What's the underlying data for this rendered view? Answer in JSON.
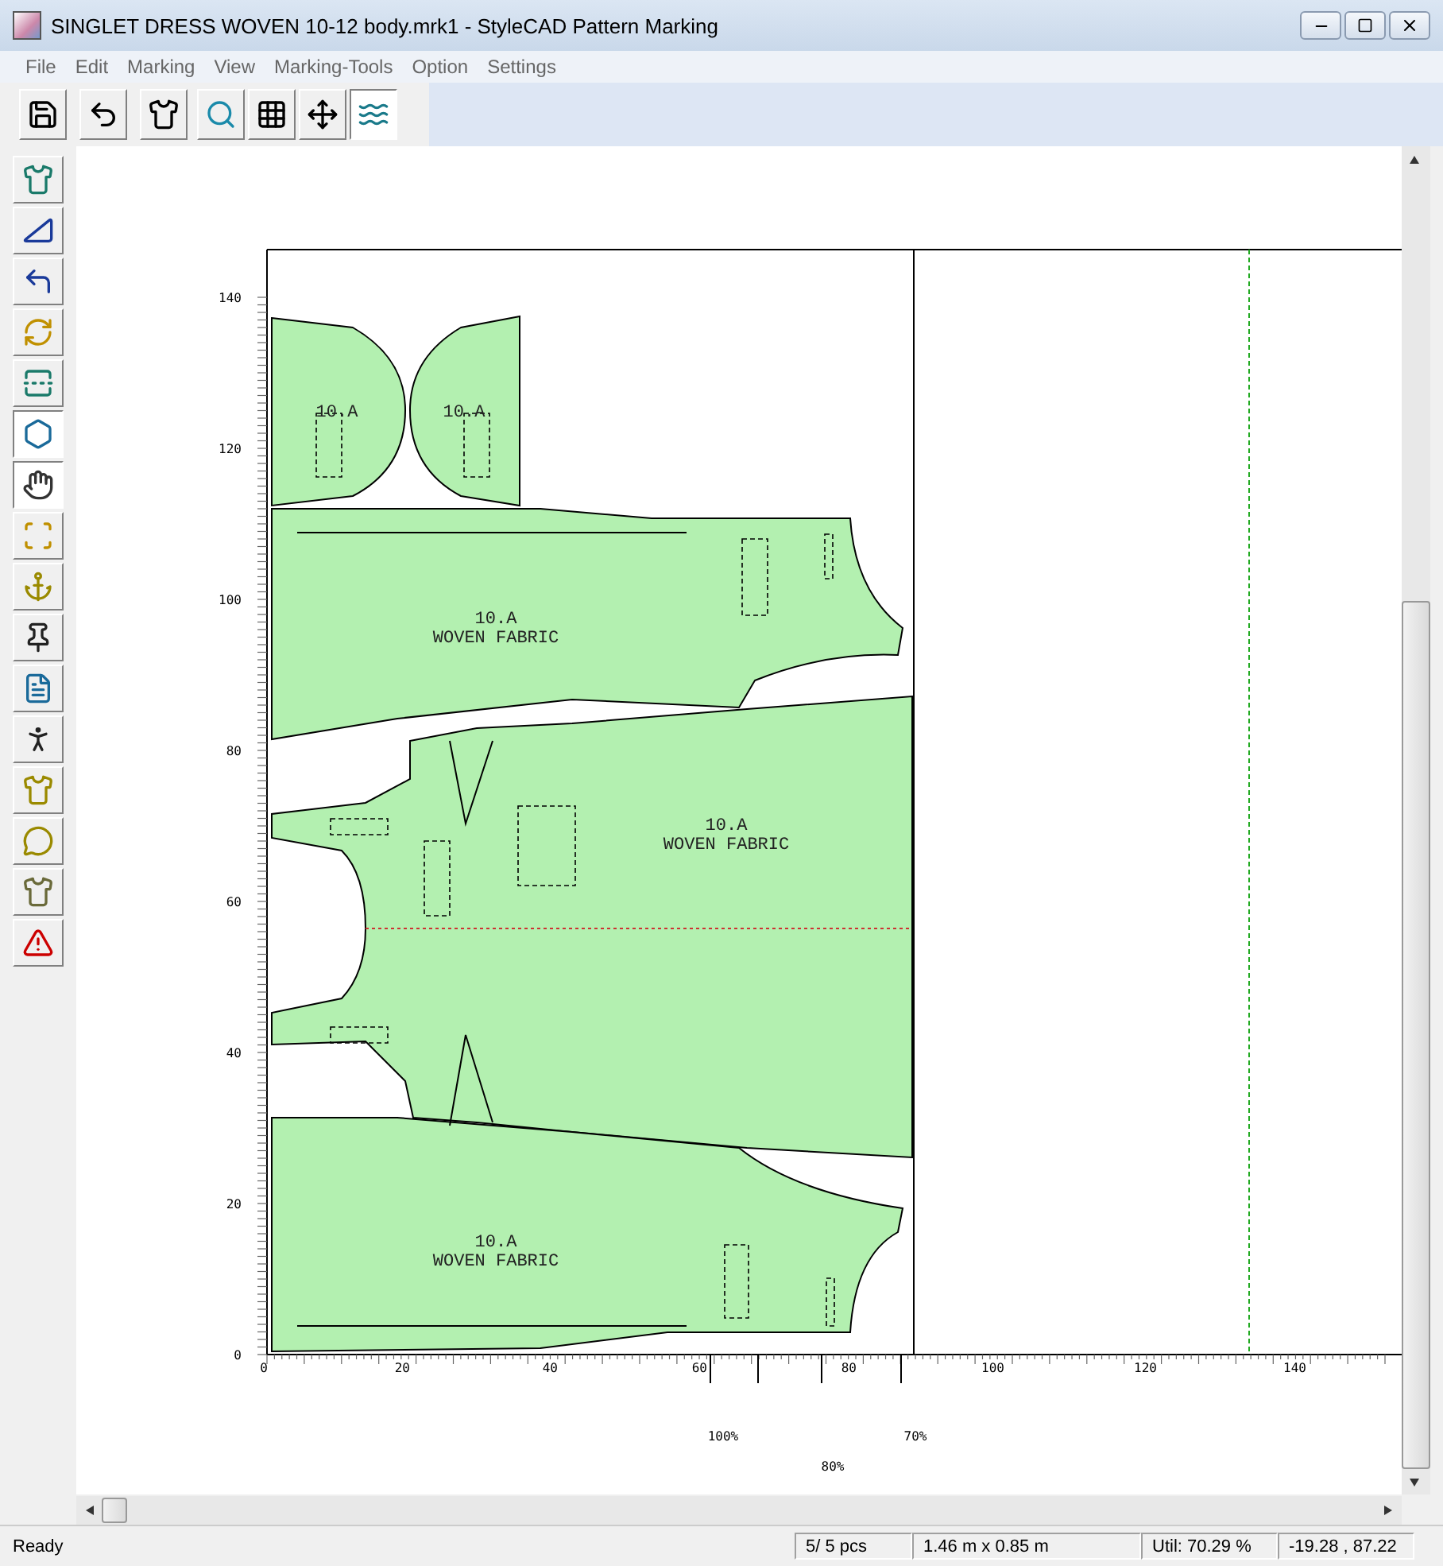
{
  "window": {
    "title": "SINGLET DRESS WOVEN 10-12 body.mrk1 - StyleCAD Pattern Marking"
  },
  "menu": [
    "File",
    "Edit",
    "Marking",
    "View",
    "Marking-Tools",
    "Option",
    "Settings"
  ],
  "toolbar": [
    {
      "selected": false
    },
    {
      "selected": false
    },
    {
      "selected": false
    },
    {
      "selected": false
    },
    {
      "selected": false
    },
    {
      "selected": false
    },
    {
      "selected": true
    }
  ],
  "tool_palette": [
    {
      "selected": false
    },
    {
      "selected": false
    },
    {
      "selected": false
    },
    {
      "selected": false
    },
    {
      "selected": false
    },
    {
      "selected": true
    },
    {
      "selected": true
    },
    {
      "selected": false
    },
    {
      "selected": false
    },
    {
      "selected": false
    },
    {
      "selected": false
    },
    {
      "selected": false
    },
    {
      "selected": false
    },
    {
      "selected": false
    },
    {
      "selected": false
    },
    {
      "selected": false
    }
  ],
  "marker": {
    "y_ruler": [
      "140",
      "120",
      "100",
      "80",
      "60",
      "40",
      "20",
      "0"
    ],
    "x_ruler": [
      "0",
      "20",
      "40",
      "60",
      "80",
      "100",
      "120",
      "140"
    ],
    "pieces": [
      {
        "lines": [
          "10.A"
        ]
      },
      {
        "lines": [
          "10.A"
        ]
      },
      {
        "lines": [
          "10.A",
          "WOVEN FABRIC"
        ]
      },
      {
        "lines": [
          "10.A",
          "WOVEN FABRIC"
        ]
      },
      {
        "lines": [
          "10.A",
          "WOVEN FABRIC"
        ]
      }
    ],
    "percent_marks": [
      "100%",
      "70%",
      "80%"
    ]
  },
  "status_bar": {
    "message": "Ready",
    "pieces": "5/ 5 pcs",
    "size": "1.46 m x 0.85 m",
    "utilization": "Util: 70.29  %",
    "cursor": "-19.28 , 87.22"
  }
}
